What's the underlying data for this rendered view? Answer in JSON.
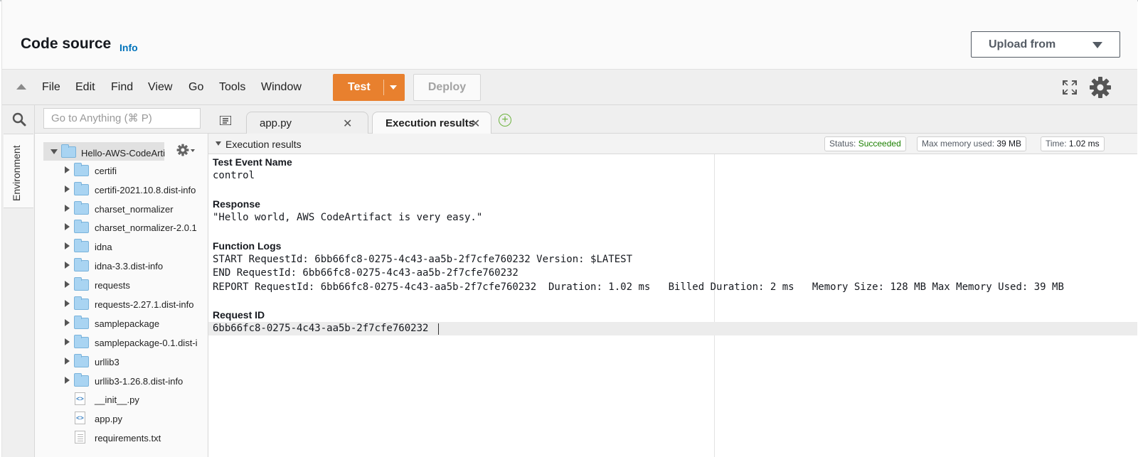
{
  "header": {
    "title": "Code source",
    "info_link": "Info",
    "upload_button": "Upload from"
  },
  "menu": {
    "items": [
      "File",
      "Edit",
      "Find",
      "View",
      "Go",
      "Tools",
      "Window"
    ],
    "test_button": "Test",
    "deploy_button": "Deploy"
  },
  "sidebar": {
    "environment_tab": "Environment",
    "goto_placeholder": "Go to Anything (⌘ P)"
  },
  "tree": {
    "root": "Hello-AWS-CodeArti",
    "folders": [
      "certifi",
      "certifi-2021.10.8.dist-info",
      "charset_normalizer",
      "charset_normalizer-2.0.1",
      "idna",
      "idna-3.3.dist-info",
      "requests",
      "requests-2.27.1.dist-info",
      "samplepackage",
      "samplepackage-0.1.dist-i",
      "urllib3",
      "urllib3-1.26.8.dist-info"
    ],
    "files": [
      "__init__.py",
      "app.py",
      "requirements.txt"
    ]
  },
  "tabs": [
    {
      "label": "app.py",
      "active": false
    },
    {
      "label": "Execution results",
      "active": true
    }
  ],
  "execution": {
    "title": "Execution results",
    "status_label": "Status:",
    "status_value": "Succeeded",
    "memory_label": "Max memory used:",
    "memory_value": "39 MB",
    "time_label": "Time:",
    "time_value": "1.02 ms",
    "test_event_name_title": "Test Event Name",
    "test_event_name": "control",
    "response_title": "Response",
    "response": "\"Hello world, AWS CodeArtifact is very easy.\"",
    "function_logs_title": "Function Logs",
    "logs": [
      "START RequestId: 6bb66fc8-0275-4c43-aa5b-2f7cfe760232 Version: $LATEST",
      "END RequestId: 6bb66fc8-0275-4c43-aa5b-2f7cfe760232",
      "REPORT RequestId: 6bb66fc8-0275-4c43-aa5b-2f7cfe760232  Duration: 1.02 ms   Billed Duration: 2 ms   Memory Size: 128 MB Max Memory Used: 39 MB"
    ],
    "request_id_title": "Request ID",
    "request_id": "6bb66fc8-0275-4c43-aa5b-2f7cfe760232"
  },
  "colors": {
    "accent_orange": "#e8802e",
    "info_blue": "#0073bb",
    "success_green": "#1d8102",
    "folder_blue": "#a9d4f2"
  }
}
